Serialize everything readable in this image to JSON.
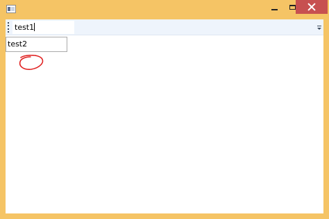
{
  "window": {
    "accent_color": "#f5c465",
    "close_color": "#c75050",
    "app_icon": "window-app-icon",
    "caption_buttons": [
      "minimize-icon",
      "maximize-icon",
      "close-icon"
    ]
  },
  "toolbar": {
    "textbox_value": "test1",
    "overflow_icon": "toolbar-overflow-icon"
  },
  "main": {
    "textbox_value": "test2"
  },
  "annotation": {
    "color": "#e02020",
    "shape": "hand-drawn-circle"
  }
}
